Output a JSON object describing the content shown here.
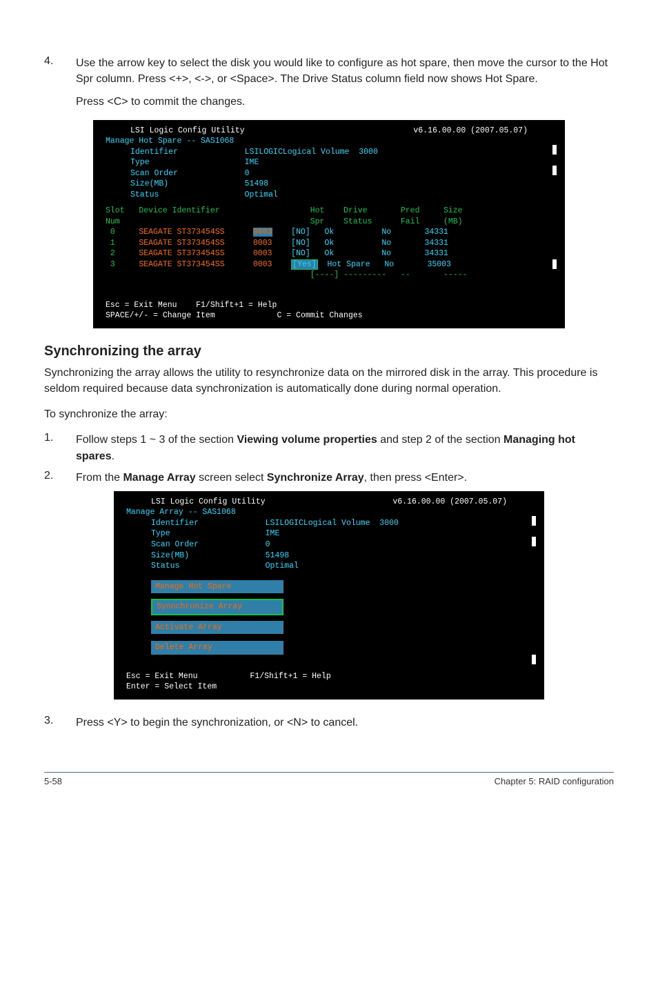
{
  "step4": {
    "num": "4.",
    "para1_a": "Use the arrow key to select the disk you would like to configure as hot spare, then move the cursor to the Hot Spr column. Press <+>, <->, or <Space>. The Drive Status column field now shows Hot Spare.",
    "para2": "Press <C> to commit the changes."
  },
  "term1": {
    "title_left": "LSI Logic Config Utility",
    "title_right": "v6.16.00.00 (2007.05.07)",
    "subtitle": "Manage Hot Spare -- SAS1068",
    "ident_lines": [
      {
        "label": "Identifier",
        "value": "LSILOGICLogical Volume  3000"
      },
      {
        "label": "Type",
        "value": "IME"
      },
      {
        "label": "Scan Order",
        "value": "0"
      },
      {
        "label": "Size(MB)",
        "value": "51498"
      },
      {
        "label": "Status",
        "value": "Optimal"
      }
    ],
    "head1": "Slot   Device Identifier                   Hot    Drive       Pred     Size",
    "head2": "Num                                        Spr    Status      Fail     (MB)",
    "rows": [
      {
        "slot": " 0",
        "dev": "SEAGATE ST373454SS",
        "code": "0003",
        "hot": "[NO] ",
        "drive": "Ok       ",
        "fail": "No",
        "size": "  34331",
        "code_hl": true
      },
      {
        "slot": " 1",
        "dev": "SEAGATE ST373454SS",
        "code": "0003",
        "hot": "[NO] ",
        "drive": "Ok       ",
        "fail": "No",
        "size": "  34331",
        "code_hl": false
      },
      {
        "slot": " 2",
        "dev": "SEAGATE ST373454SS",
        "code": "0003",
        "hot": "[NO] ",
        "drive": "Ok       ",
        "fail": "No",
        "size": "  34331",
        "code_hl": false
      },
      {
        "slot": " 3",
        "dev": "SEAGATE ST373454SS",
        "code": "0003",
        "hot": "[Yes]",
        "drive": "Hot Spare",
        "fail": "No",
        "size": "  35003",
        "code_hl": false,
        "hot_hl": true
      }
    ],
    "dashrow": "                                           [----] ---------   --       -----",
    "footer1": "Esc = Exit Menu    F1/Shift+1 = Help",
    "footer2": "SPACE/+/- = Change Item             C = Commit Changes"
  },
  "sync": {
    "heading": "Synchronizing the array",
    "para1": "Synchronizing the array allows the utility to resynchronize data on the mirrored disk in the array. This procedure is seldom required because data synchronization is automatically done during normal operation.",
    "para2": "To synchronize the array:",
    "step1_num": "1.",
    "step1_text_a": "Follow steps 1 ~ 3 of the section ",
    "step1_bold_a": "Viewing volume properties",
    "step1_text_b": " and step 2 of the section ",
    "step1_bold_b": "Managing hot spares",
    "step1_text_c": ".",
    "step2_num": "2.",
    "step2_text_a": "From the ",
    "step2_bold_a": "Manage Array",
    "step2_text_b": " screen select ",
    "step2_bold_b": "Synchronize Array",
    "step2_text_c": ", then press <Enter>."
  },
  "term2": {
    "title_left": "LSI Logic Config Utility",
    "title_right": "v6.16.00.00 (2007.05.07)",
    "subtitle": "Manage Array -- SAS1068",
    "ident_lines": [
      {
        "label": "Identifier",
        "value": "LSILOGICLogical Volume  3000"
      },
      {
        "label": "Type",
        "value": "IME"
      },
      {
        "label": "Scan Order",
        "value": "0"
      },
      {
        "label": "Size(MB)",
        "value": "51498"
      },
      {
        "label": "Status",
        "value": "Optimal"
      }
    ],
    "menu": [
      {
        "label": "Manage Hot Spare",
        "selected": false
      },
      {
        "label": "Synnchronize Array",
        "selected": true
      },
      {
        "label": "Activate Array",
        "selected": false
      },
      {
        "label": "Delete Array",
        "selected": false
      }
    ],
    "footer1": "Esc = Exit Menu           F1/Shift+1 = Help",
    "footer2": "Enter = Select Item"
  },
  "step3": {
    "num": "3.",
    "text": "Press <Y> to begin the synchronization, or <N> to cancel."
  },
  "footer": {
    "left": "5-58",
    "right": "Chapter 5: RAID configuration"
  }
}
